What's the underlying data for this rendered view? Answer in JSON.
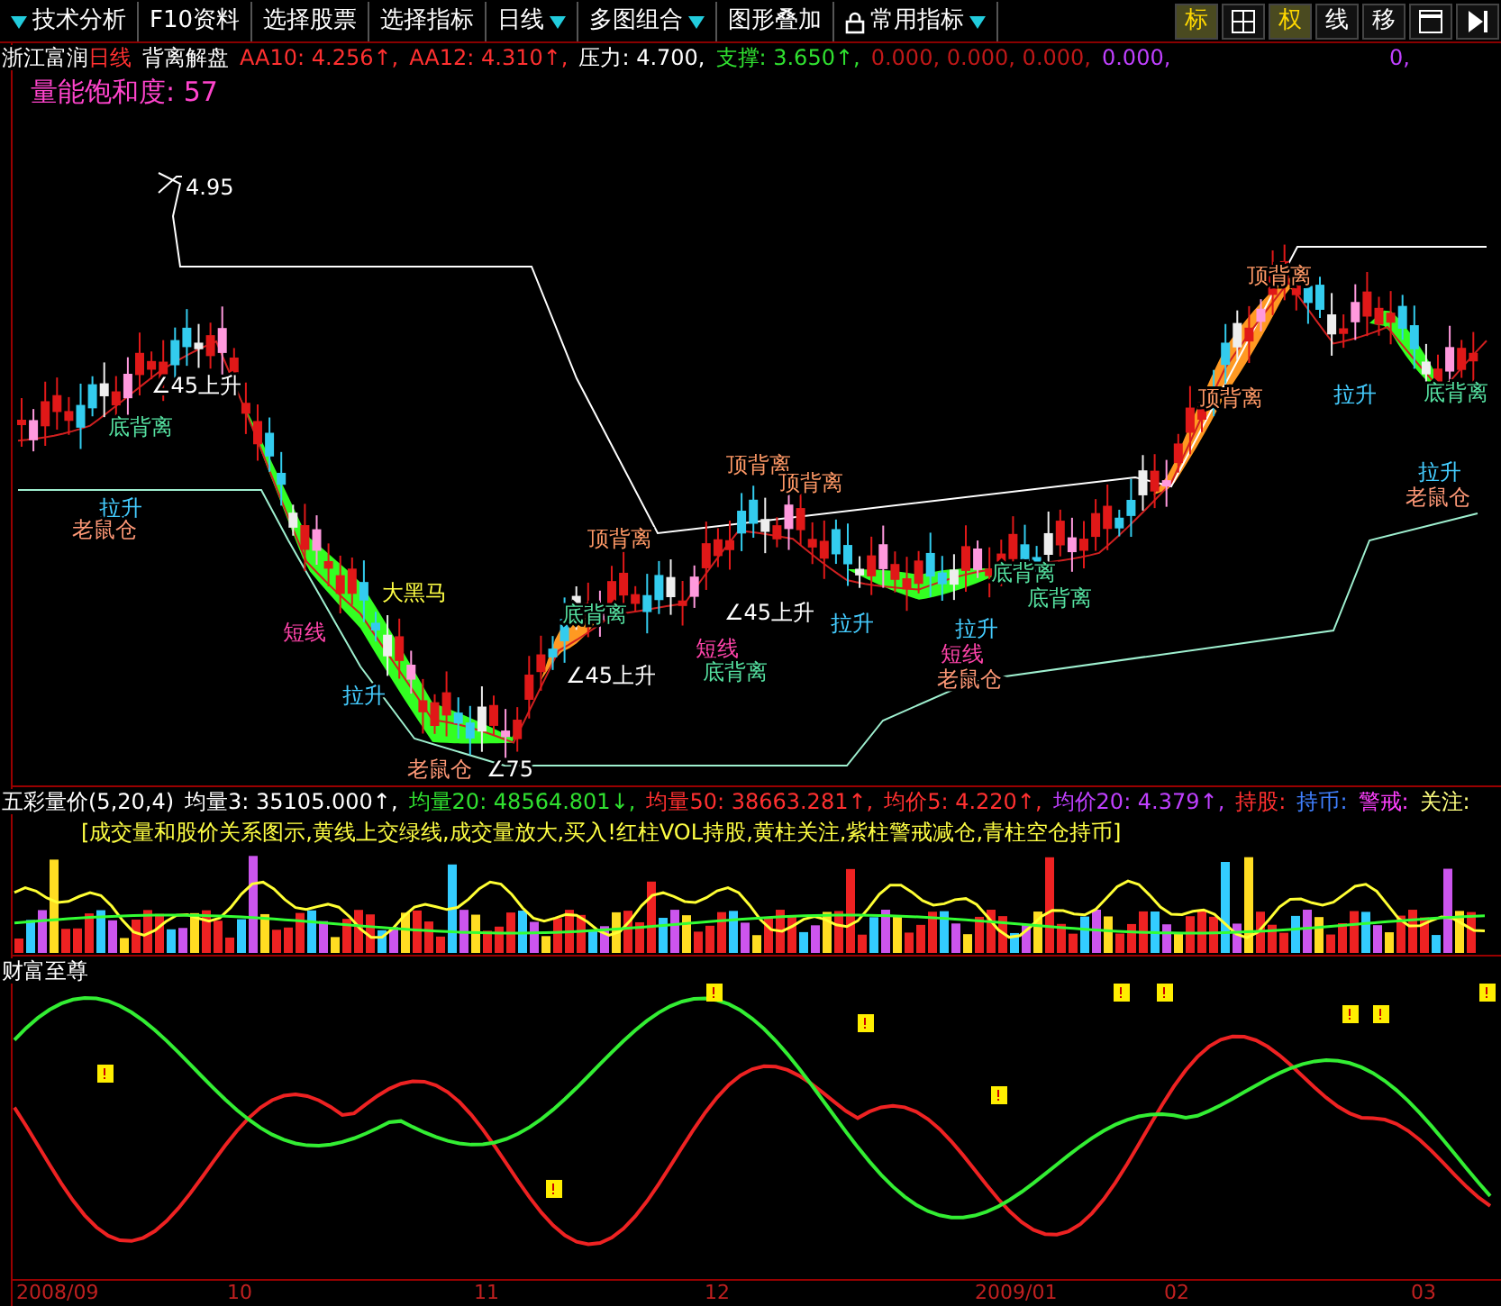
{
  "toolbar": {
    "menus": [
      {
        "label": "技术分析",
        "caret_before": true
      },
      {
        "label": "F10资料"
      },
      {
        "label": "选择股票"
      },
      {
        "label": "选择指标"
      },
      {
        "label": "日线",
        "caret_after": true
      },
      {
        "label": "多图组合",
        "caret_after": true
      },
      {
        "label": "图形叠加"
      },
      {
        "label": "常用指标",
        "caret_after": true,
        "locked": true
      }
    ],
    "tools": [
      {
        "kind": "text",
        "label": "标",
        "selected": true
      },
      {
        "kind": "grid",
        "selected": false
      },
      {
        "kind": "text",
        "label": "权",
        "selected": true
      },
      {
        "kind": "text",
        "label": "线",
        "selected": false
      },
      {
        "kind": "text",
        "label": "移",
        "selected": false
      },
      {
        "kind": "window",
        "selected": false
      },
      {
        "kind": "end",
        "selected": false
      }
    ]
  },
  "main_panel": {
    "stock": "浙江富润",
    "period": "日线",
    "indicator": "背离解盘",
    "values": [
      {
        "text": "AA10: 4.256↑,",
        "color": "#ff3030"
      },
      {
        "text": "AA12: 4.310↑,",
        "color": "#ff3030"
      },
      {
        "text": "压力: 4.700,",
        "color": "#ffffff"
      },
      {
        "text": "支撑: 3.650↑,",
        "color": "#30e030"
      },
      {
        "text": "0.000, 0.000, 0.000,",
        "color": "#c01818"
      },
      {
        "text": "0.000,",
        "color": "#c040ff"
      }
    ],
    "trailing": {
      "text": "0,",
      "color": "#c040ff"
    },
    "saturation": "量能饱和度: 57",
    "chart_labels": [
      {
        "text": "∠45上升",
        "kind": "angle"
      },
      {
        "text": "底背离",
        "kind": "bottom"
      },
      {
        "text": "拉升",
        "kind": "rise"
      },
      {
        "text": "老鼠仓",
        "kind": "rat"
      },
      {
        "text": "大黑马",
        "kind": "horse"
      },
      {
        "text": "短线",
        "kind": "short"
      },
      {
        "text": "拉升",
        "kind": "rise"
      },
      {
        "text": "老鼠仓",
        "kind": "rat"
      },
      {
        "text": "∠75",
        "kind": "angle"
      },
      {
        "text": "顶背离",
        "kind": "top"
      },
      {
        "text": "底背离",
        "kind": "bottom"
      },
      {
        "text": "∠45上升",
        "kind": "angle"
      },
      {
        "text": "∠45上升",
        "kind": "angle"
      },
      {
        "text": "短线",
        "kind": "short"
      },
      {
        "text": "底背离",
        "kind": "bottom"
      },
      {
        "text": "顶背离",
        "kind": "top"
      },
      {
        "text": "顶背离",
        "kind": "top"
      },
      {
        "text": "拉升",
        "kind": "rise"
      },
      {
        "text": "底背离",
        "kind": "bottom"
      },
      {
        "text": "底背离",
        "kind": "bottom"
      },
      {
        "text": "拉升",
        "kind": "rise"
      },
      {
        "text": "短线",
        "kind": "short"
      },
      {
        "text": "老鼠仓",
        "kind": "rat"
      },
      {
        "text": "顶背离",
        "kind": "top"
      },
      {
        "text": "顶背离",
        "kind": "top"
      },
      {
        "text": "拉升",
        "kind": "rise"
      },
      {
        "text": "底背离",
        "kind": "bottom"
      },
      {
        "text": "拉升",
        "kind": "rise"
      },
      {
        "text": "老鼠仓",
        "kind": "rat"
      },
      {
        "text": "4.95",
        "kind": "price"
      }
    ]
  },
  "volume_panel": {
    "title": "五彩量价(5,20,4)",
    "values": [
      {
        "text": "均量3: 35105.000↑,",
        "color": "#ffffff"
      },
      {
        "text": "均量20: 48564.801↓,",
        "color": "#30e030"
      },
      {
        "text": "均量50: 38663.281↑,",
        "color": "#ff3030"
      },
      {
        "text": "均价5: 4.220↑,",
        "color": "#ff3030"
      },
      {
        "text": "均价20: 4.379↑,",
        "color": "#c040ff"
      },
      {
        "text": "持股:",
        "color": "#ff3030"
      },
      {
        "text": "持币:",
        "color": "#4080ff"
      },
      {
        "text": "警戒:",
        "color": "#ff40ff"
      },
      {
        "text": "关注:",
        "color": "#ffff80"
      }
    ],
    "legend": "[成交量和股价关系图示,黄线上交绿线,成交量放大,买入!红柱VOL持股,黄柱关注,紫柱警戒减仓,青柱空仓持币]"
  },
  "oscillator_panel": {
    "title": "财富至尊"
  },
  "x_axis": [
    "2008/09",
    "10",
    "11",
    "12",
    "2009/01",
    "02",
    "03"
  ]
}
